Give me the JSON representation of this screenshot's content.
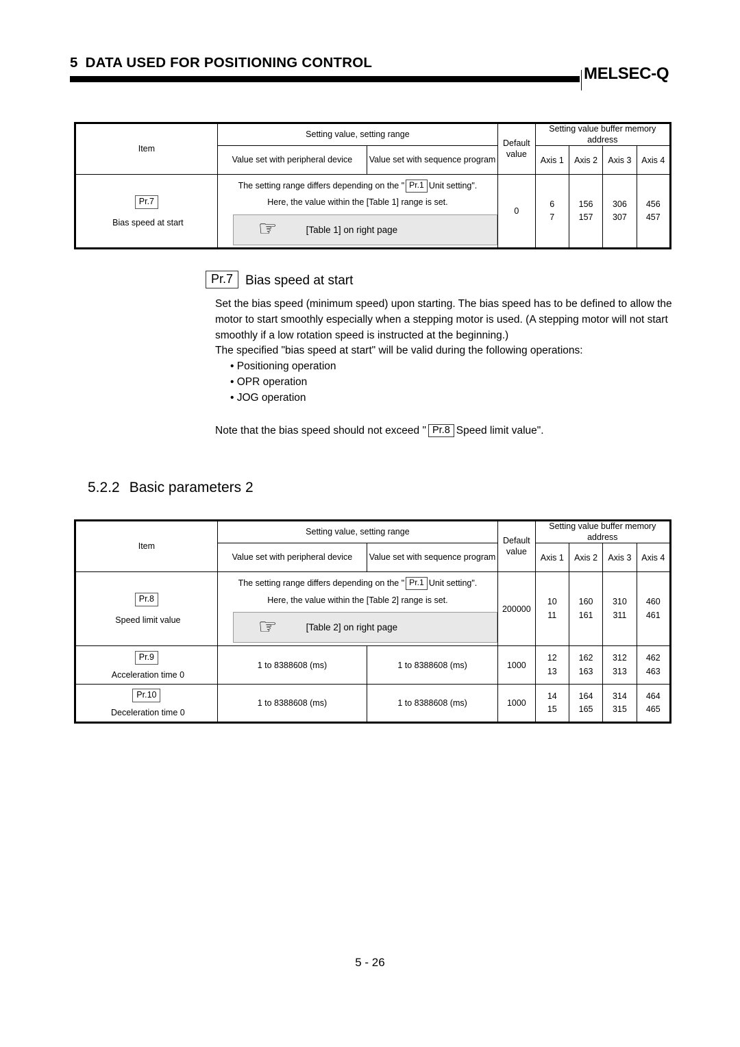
{
  "header": {
    "chapter_number": "5",
    "chapter_title": "DATA USED FOR POSITIONING CONTROL",
    "brand": "MELSEC-Q"
  },
  "table_headers": {
    "item": "Item",
    "setting_group": "Setting value, setting range",
    "peripheral": "Value set with peripheral device",
    "sequence": "Value set with sequence program",
    "default_line1": "Default",
    "default_line2": "value",
    "address_group_line1": "Setting value buffer memory",
    "address_group_line2": "address",
    "axis1": "Axis 1",
    "axis2": "Axis 2",
    "axis3": "Axis 3",
    "axis4": "Axis 4"
  },
  "table1": {
    "rows": [
      {
        "pr": "Pr.7",
        "name": "Bias speed at start",
        "range_note_pre": "The setting range differs depending on the \"",
        "range_note_box": "Pr.1",
        "range_note_post": "Unit setting\".",
        "range_note_line2": "Here, the value within the [Table 1] range is set.",
        "callout_icon": "pointing-hand-icon",
        "callout_text": "[Table 1] on right page",
        "default": "0",
        "axis1_a": "6",
        "axis1_b": "7",
        "axis2_a": "156",
        "axis2_b": "157",
        "axis3_a": "306",
        "axis3_b": "307",
        "axis4_a": "456",
        "axis4_b": "457"
      }
    ]
  },
  "explanation": {
    "pr_box": "Pr.7",
    "title": "Bias speed at start",
    "paragraph1": "Set the bias speed (minimum speed) upon starting.  The bias speed has to be defined to allow the motor to start smoothly especially when a stepping motor is used.  (A stepping motor will not start smoothly if a low rotation speed is instructed at the beginning.)",
    "paragraph2": "The specified \"bias speed at start\" will be valid during the following operations:",
    "bullets": [
      "• Positioning operation",
      "• OPR operation",
      "• JOG operation"
    ],
    "note_pre": "Note that the bias speed should not exceed \"",
    "note_box": "Pr.8",
    "note_post": "Speed limit value\"."
  },
  "section": {
    "number": "5.2.2",
    "title": "Basic parameters 2"
  },
  "table2": {
    "rows": [
      {
        "pr": "Pr.8",
        "name": "Speed limit value",
        "range_note_pre": "The setting range differs depending on the \"",
        "range_note_box": "Pr.1",
        "range_note_post": "Unit setting\".",
        "range_note_line2": "Here, the value within the [Table 2] range is set.",
        "callout_icon": "pointing-hand-icon",
        "callout_text": "[Table 2] on right page",
        "default": "200000",
        "axis1_a": "10",
        "axis1_b": "11",
        "axis2_a": "160",
        "axis2_b": "161",
        "axis3_a": "310",
        "axis3_b": "311",
        "axis4_a": "460",
        "axis4_b": "461"
      },
      {
        "pr": "Pr.9",
        "name": "Acceleration time 0",
        "peripheral": "1 to 8388608 (ms)",
        "sequence": "1 to 8388608 (ms)",
        "default": "1000",
        "axis1_a": "12",
        "axis1_b": "13",
        "axis2_a": "162",
        "axis2_b": "163",
        "axis3_a": "312",
        "axis3_b": "313",
        "axis4_a": "462",
        "axis4_b": "463"
      },
      {
        "pr": "Pr.10",
        "name": "Deceleration time 0",
        "peripheral": "1 to 8388608 (ms)",
        "sequence": "1 to 8388608 (ms)",
        "default": "1000",
        "axis1_a": "14",
        "axis1_b": "15",
        "axis2_a": "164",
        "axis2_b": "165",
        "axis3_a": "314",
        "axis3_b": "315",
        "axis4_a": "464",
        "axis4_b": "465"
      }
    ]
  },
  "footer": {
    "page_number": "5 - 26"
  },
  "colors": {
    "callout_bg": "#e8e8e8",
    "callout_border": "#9a9a9a",
    "rule": "#000000"
  }
}
